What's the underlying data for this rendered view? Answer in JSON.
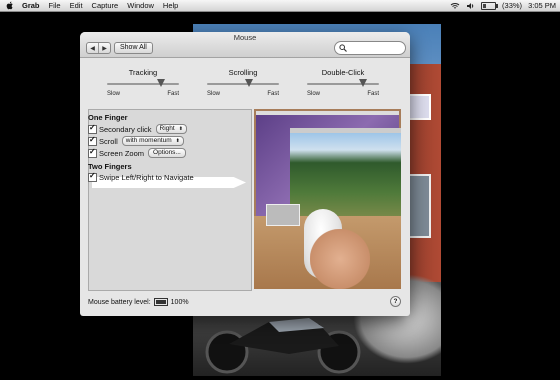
{
  "menubar": {
    "app": "Grab",
    "items": [
      "File",
      "Edit",
      "Capture",
      "Window",
      "Help"
    ],
    "battery": "(33%)",
    "clock": "3:05 PM"
  },
  "window": {
    "title": "Mouse",
    "nav_back": "◀",
    "nav_forward": "▶",
    "show_all": "Show All",
    "search_placeholder": ""
  },
  "sliders": [
    {
      "label": "Tracking",
      "min": "Slow",
      "max": "Fast",
      "level": 0.75
    },
    {
      "label": "Scrolling",
      "min": "Slow",
      "max": "Fast",
      "level": 0.58
    },
    {
      "label": "Double-Click",
      "min": "Slow",
      "max": "Fast",
      "level": 0.78
    }
  ],
  "one_finger": {
    "heading": "One Finger",
    "secondary_click": {
      "label": "Secondary click",
      "checked": true,
      "value": "Right"
    },
    "scroll": {
      "label": "Scroll",
      "checked": true,
      "value": "with momentum"
    },
    "screen_zoom": {
      "label": "Screen Zoom",
      "checked": true,
      "button": "Options..."
    }
  },
  "two_fingers": {
    "heading": "Two Fingers",
    "swipe": {
      "label": "Swipe Left/Right to Navigate",
      "checked": true
    }
  },
  "footer": {
    "battery_label": "Mouse battery level:",
    "battery_value": "100%",
    "battery_level": 1.0,
    "help": "?"
  }
}
